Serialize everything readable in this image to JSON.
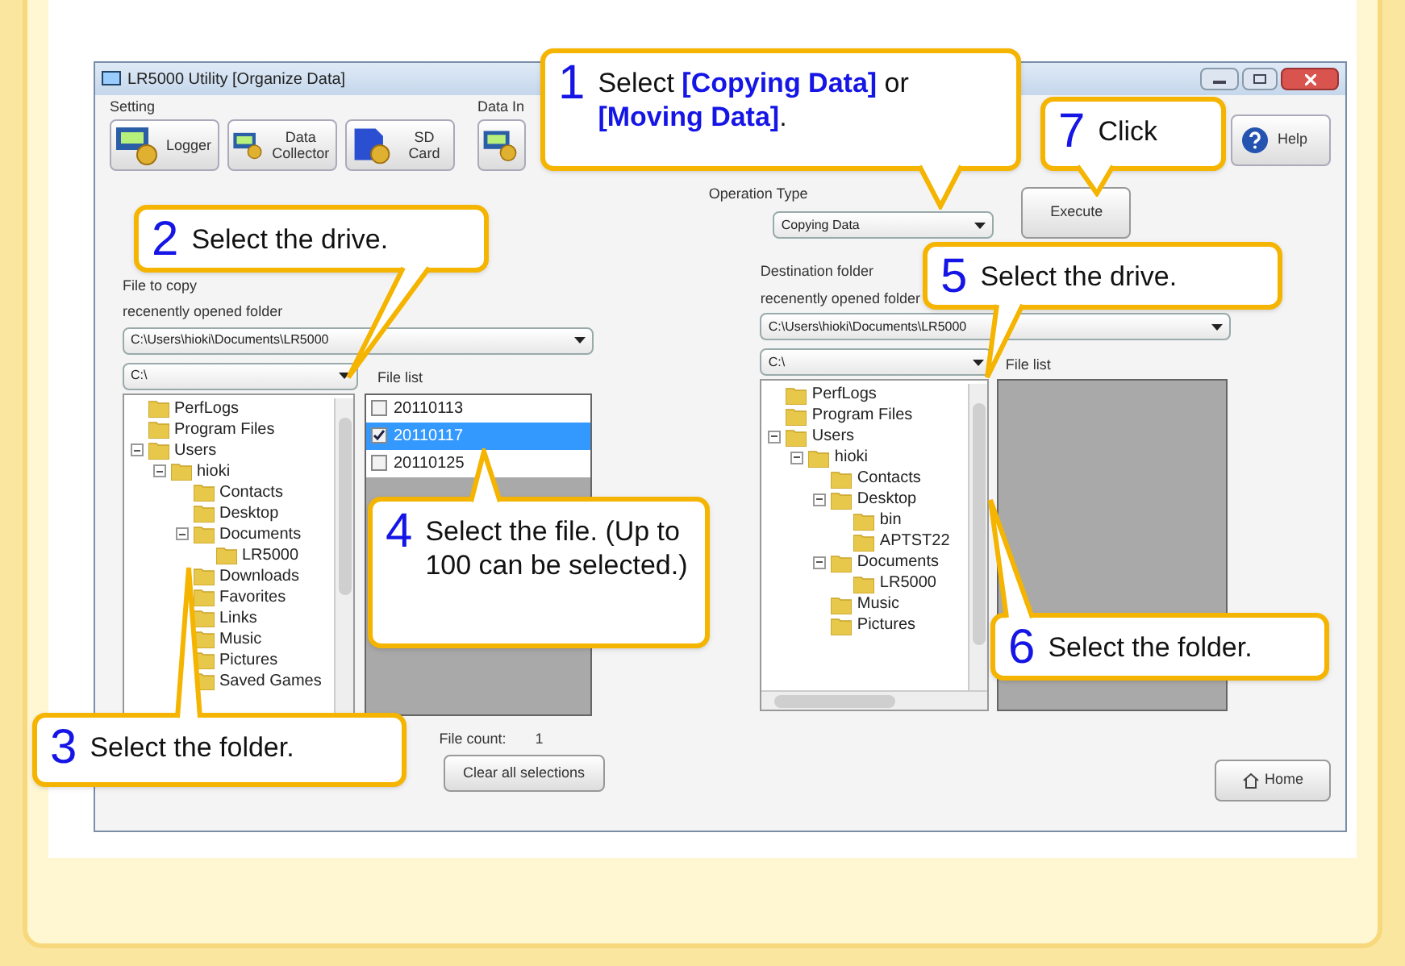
{
  "window": {
    "title": "LR5000 Utility [Organize Data]"
  },
  "setting": {
    "label": "Setting",
    "buttons": [
      {
        "label": "Logger",
        "kind": "logger"
      },
      {
        "label": "Data Collector",
        "kind": "collector"
      },
      {
        "label": "SD Card",
        "kind": "sdcard"
      }
    ]
  },
  "data_group": {
    "label": "Data In"
  },
  "help_button": {
    "label": "Help"
  },
  "operation": {
    "label": "Operation Type",
    "value": "Copying Data",
    "execute_button": "Execute"
  },
  "source": {
    "label": "File to copy",
    "recent_label": "recenently opened folder",
    "path": "C:\\Users\\hioki\\Documents\\LR5000",
    "drive": "C:\\",
    "tree": [
      {
        "name": "PerfLogs"
      },
      {
        "name": "Program Files"
      },
      {
        "name": "Users",
        "children": [
          {
            "name": "hioki",
            "children": [
              {
                "name": "Contacts"
              },
              {
                "name": "Desktop"
              },
              {
                "name": "Documents",
                "children": [
                  {
                    "name": "LR5000"
                  }
                ]
              },
              {
                "name": "Downloads"
              },
              {
                "name": "Favorites"
              },
              {
                "name": "Links"
              },
              {
                "name": "Music"
              },
              {
                "name": "Pictures"
              },
              {
                "name": "Saved Games"
              }
            ]
          }
        ]
      }
    ],
    "file_list_label": "File list",
    "files": [
      {
        "name": "20110113",
        "checked": false,
        "selected": false
      },
      {
        "name": "20110117",
        "checked": true,
        "selected": true
      },
      {
        "name": "20110125",
        "checked": false,
        "selected": false
      }
    ],
    "file_count_label": "File count:",
    "file_count": "1",
    "clear_button": "Clear all selections"
  },
  "destination": {
    "label": "Destination folder",
    "recent_label": "recenently opened folder",
    "path": "C:\\Users\\hioki\\Documents\\LR5000",
    "drive": "C:\\",
    "tree": [
      {
        "name": "PerfLogs"
      },
      {
        "name": "Program Files"
      },
      {
        "name": "Users",
        "children": [
          {
            "name": "hioki",
            "children": [
              {
                "name": "Contacts"
              },
              {
                "name": "Desktop",
                "children": [
                  {
                    "name": "bin"
                  },
                  {
                    "name": "APTST22"
                  }
                ]
              },
              {
                "name": "Documents",
                "children": [
                  {
                    "name": "LR5000"
                  }
                ]
              },
              {
                "name": "Music"
              },
              {
                "name": "Pictures"
              }
            ]
          }
        ]
      }
    ],
    "file_list_label": "File list"
  },
  "home_button": "Home",
  "callouts": [
    {
      "number": "1",
      "text": "Select **[Copying Data]** or **[Moving Data]**."
    },
    {
      "number": "7",
      "text": "Click"
    },
    {
      "number": "2",
      "text": "Select the drive."
    },
    {
      "number": "5",
      "text": "Select the drive."
    },
    {
      "number": "4",
      "text": "Select the file. (Up to 100 can be selected.)"
    },
    {
      "number": "6",
      "text": "Select the folder."
    },
    {
      "number": "3",
      "text": "Select the folder."
    }
  ]
}
